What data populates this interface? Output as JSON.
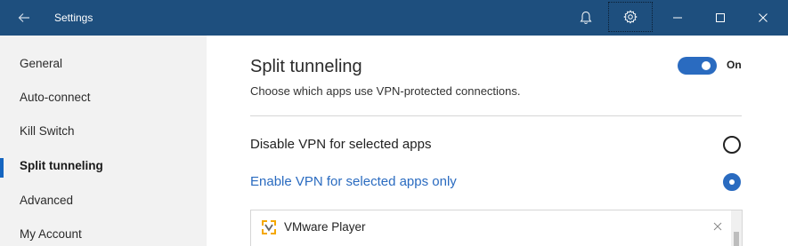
{
  "window": {
    "title": "Settings"
  },
  "titlebar_icons": [
    "back-arrow-icon",
    "bell-icon",
    "gear-icon",
    "minimize-icon",
    "maximize-icon",
    "close-icon"
  ],
  "sidebar": {
    "items": [
      {
        "label": "General"
      },
      {
        "label": "Auto-connect"
      },
      {
        "label": "Kill Switch"
      },
      {
        "label": "Split tunneling",
        "active": true
      },
      {
        "label": "Advanced"
      },
      {
        "label": "My Account"
      }
    ]
  },
  "main": {
    "title": "Split tunneling",
    "subtitle": "Choose which apps use VPN-protected connections.",
    "toggle": {
      "state_label": "On",
      "checked": true
    },
    "options": [
      {
        "label": "Disable VPN for selected apps",
        "selected": false
      },
      {
        "label": "Enable VPN for selected apps only",
        "selected": true
      }
    ],
    "apps": [
      {
        "name": "VMware Player",
        "icon": "vmware-icon"
      }
    ]
  },
  "colors": {
    "titlebar": "#1e4f7e",
    "accent": "#2a6bc0",
    "sidebar_bg": "#f2f2f2"
  }
}
